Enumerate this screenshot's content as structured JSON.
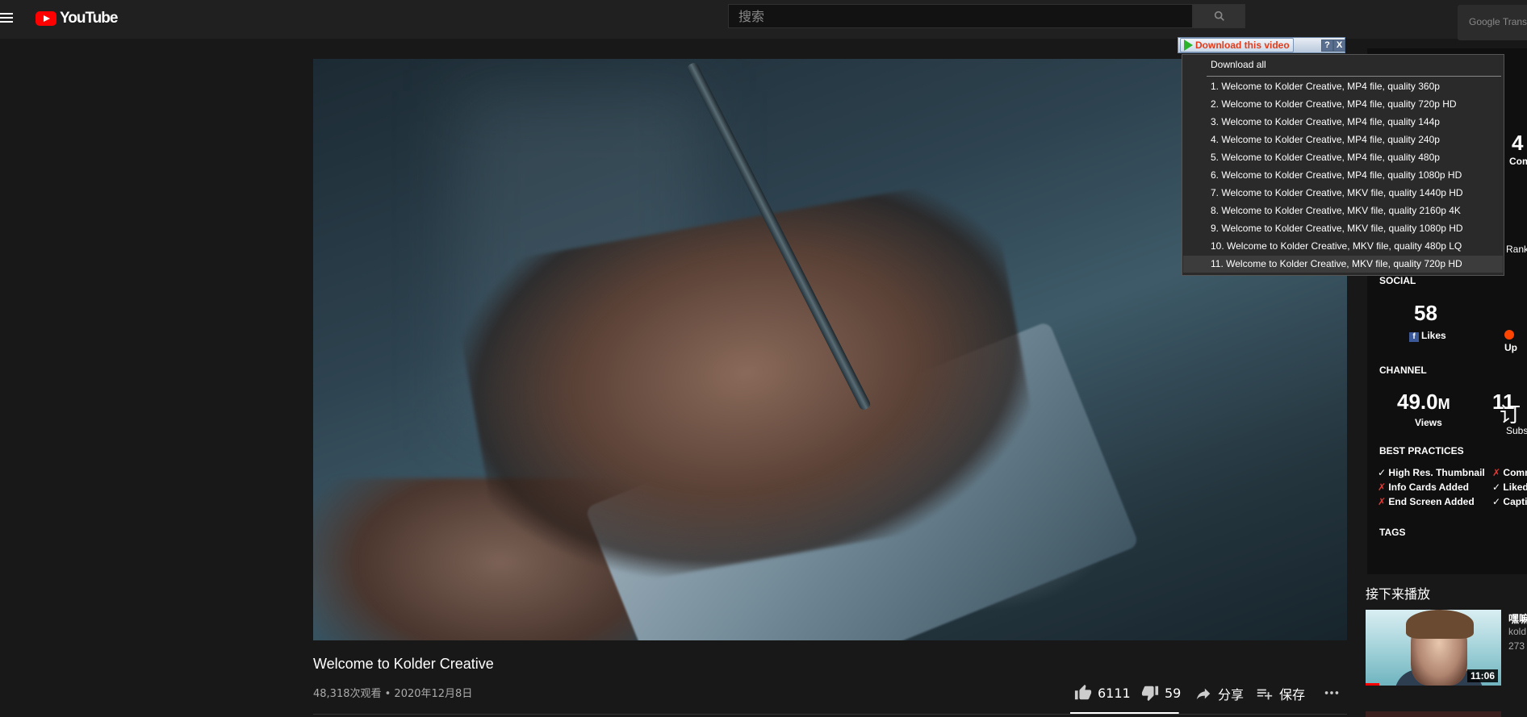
{
  "header": {
    "logo_text": "YouTube",
    "search_placeholder": "搜索",
    "extension_label": "Google Trans"
  },
  "video": {
    "title": "Welcome to Kolder Creative",
    "meta": "48,318次观看 • 2020年12月8日",
    "likes": "6111",
    "dislikes": "59",
    "share_label": "分享",
    "save_label": "保存",
    "like_ratio": 0.99
  },
  "download_popup": {
    "button_label": "Download this video",
    "help_label": "?",
    "close_label": "X",
    "download_all": "Download all",
    "items": [
      "1.  Welcome to Kolder Creative,  MP4 file, quality 360p",
      "2.  Welcome to Kolder Creative,  MP4 file, quality 720p HD",
      "3.  Welcome to Kolder Creative,  MP4 file, quality 144p",
      "4.  Welcome to Kolder Creative,  MP4 file, quality 240p",
      "5.  Welcome to Kolder Creative,  MP4 file, quality 480p",
      "6.  Welcome to Kolder Creative,  MP4 file, quality 1080p HD",
      "7.  Welcome to Kolder Creative,  MKV file, quality 1440p HD",
      "8.  Welcome to Kolder Creative,  MKV file, quality 2160p 4K",
      "9.  Welcome to Kolder Creative,  MKV file, quality 1080p HD",
      "10.  Welcome to Kolder Creative,  MKV file, quality 480p LQ",
      "11.  Welcome to Kolder Creative,  MKV file, quality 720p HD"
    ]
  },
  "side_panel": {
    "partial_num": "4",
    "partial_com": "Com",
    "partial_rank": "Rank",
    "social_title": "SOCIAL",
    "likes_num": "58",
    "likes_label": "Likes",
    "fb_letter": "f",
    "up_label": "Up",
    "channel_title": "CHANNEL",
    "views_num": "49.0",
    "views_unit": "M",
    "views_label": "Views",
    "subs_num": "11",
    "subs_label": "Subs",
    "subscribe_overlay": "订",
    "best_practices_title": "BEST PRACTICES",
    "check_mark": "✓",
    "cross_mark": "✗",
    "bp_left": [
      "High Res. Thumbnail",
      "Info Cards Added",
      "End Screen Added"
    ],
    "bp_right": [
      "Comm",
      "Liked",
      "Captio"
    ],
    "tags_title": "TAGS"
  },
  "up_next": {
    "heading": "接下来播放",
    "duration": "11:06",
    "title": "嘿嘛",
    "channel": "kold",
    "views": "273"
  }
}
